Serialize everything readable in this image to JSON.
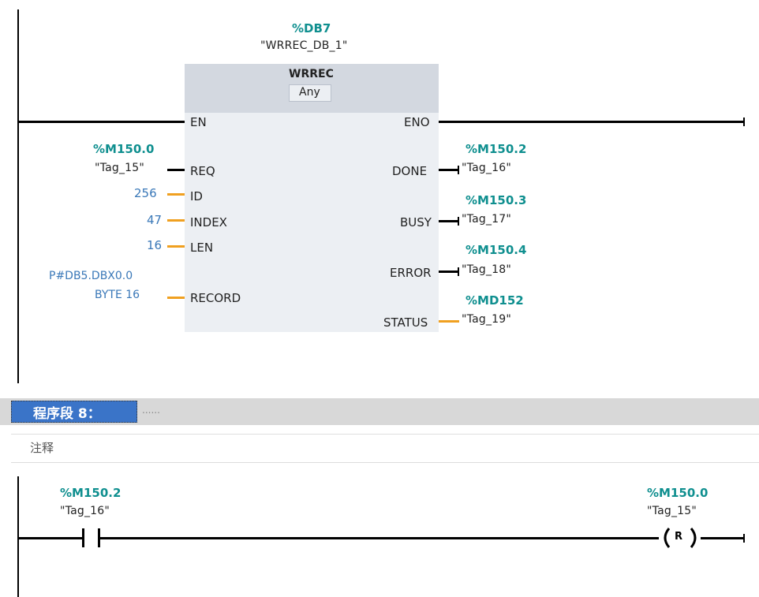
{
  "network7": {
    "instance_address": "%DB7",
    "instance_name": "\"WRREC_DB_1\"",
    "block": {
      "name": "WRREC",
      "type": "Any",
      "en": "EN",
      "eno": "ENO",
      "inputs": [
        {
          "pin": "REQ",
          "address": "%M150.0",
          "tag": "\"Tag_15\""
        },
        {
          "pin": "ID",
          "value": "256"
        },
        {
          "pin": "INDEX",
          "value": "47"
        },
        {
          "pin": "LEN",
          "value": "16"
        },
        {
          "pin": "RECORD",
          "value_line1": "P#DB5.DBX0.0",
          "value_line2": "BYTE 16"
        }
      ],
      "outputs": [
        {
          "pin": "DONE",
          "address": "%M150.2",
          "tag": "\"Tag_16\""
        },
        {
          "pin": "BUSY",
          "address": "%M150.3",
          "tag": "\"Tag_17\""
        },
        {
          "pin": "ERROR",
          "address": "%M150.4",
          "tag": "\"Tag_18\""
        },
        {
          "pin": "STATUS",
          "address": "%MD152",
          "tag": "\"Tag_19\""
        }
      ]
    }
  },
  "network8": {
    "title": "程序段 8：",
    "title_placeholder": "......",
    "comment": "注释",
    "contact": {
      "address": "%M150.2",
      "tag": "\"Tag_16\""
    },
    "coil": {
      "address": "%M150.0",
      "tag": "\"Tag_15\"",
      "symbol": "R"
    }
  },
  "colors": {
    "teal_address": "#0f8f8f",
    "constant_blue": "#3a78b8",
    "orange_wire": "#f0a020",
    "block_body": "#eceff3",
    "block_header": "#d3d8e0",
    "network_title_bg": "#3a74c8"
  }
}
